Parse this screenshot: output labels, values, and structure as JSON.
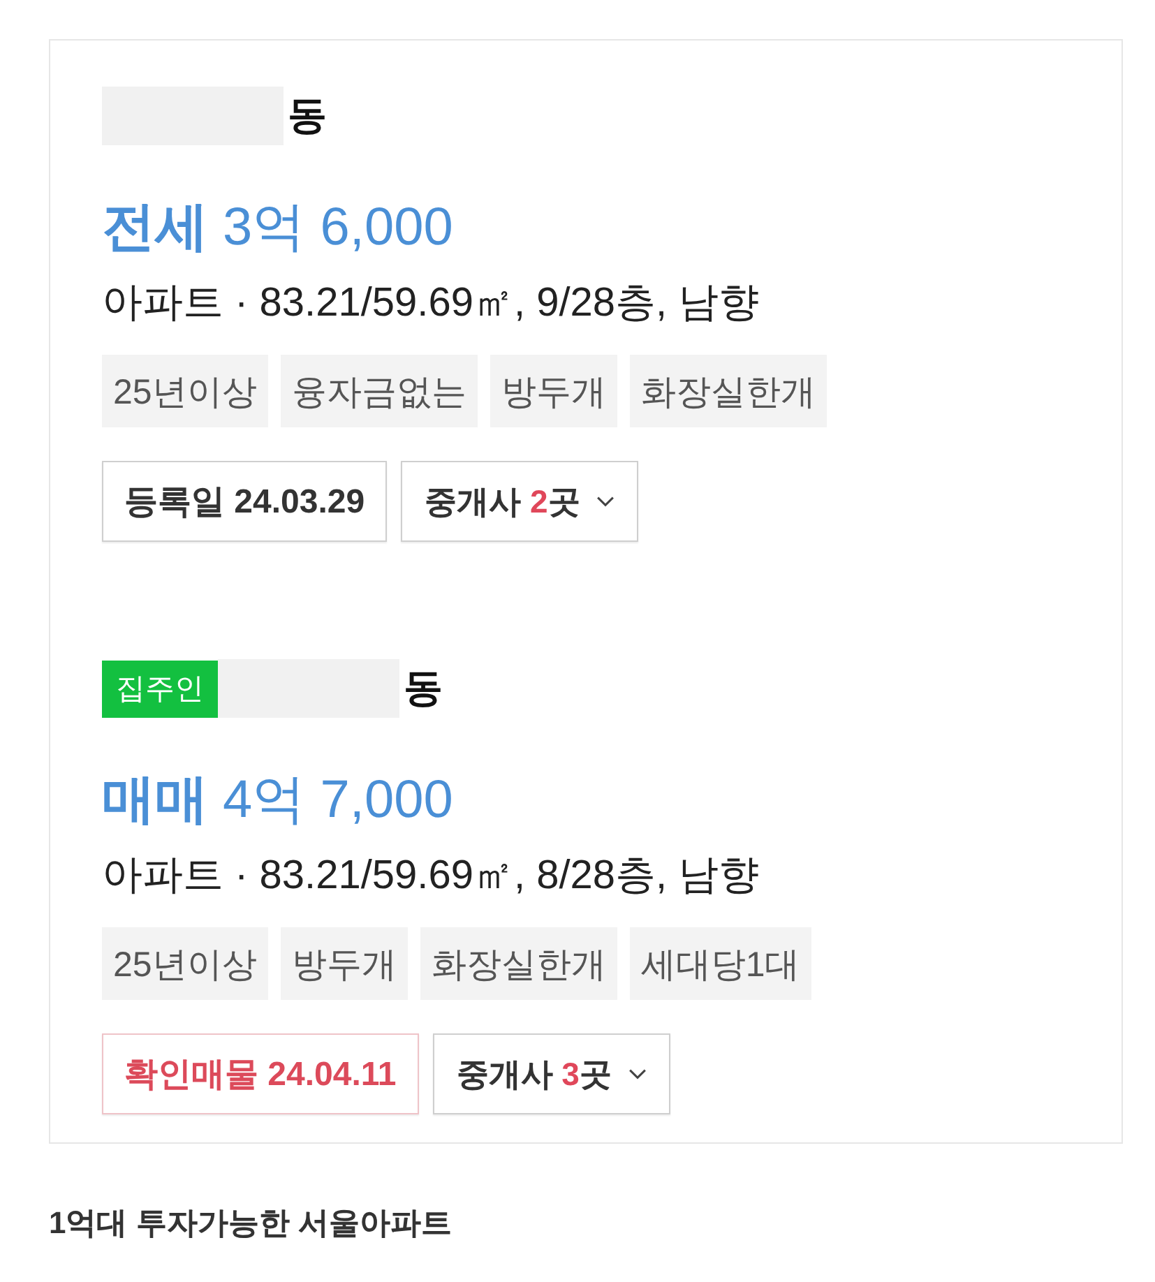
{
  "listings": [
    {
      "name_suffix": "동",
      "price": "**전세** 3억 6,000",
      "details": "아파트 · 83.21/59.69㎡, 9/28층, 남향",
      "tags": [
        "25년이상",
        "융자금없는",
        "방두개",
        "화장실한개"
      ],
      "date": {
        "kind": "registered",
        "text": "등록일 24.03.29"
      },
      "agents": {
        "label": "중개사",
        "count": "2",
        "unit": "곳"
      }
    },
    {
      "owner_badge": "집주인",
      "name_suffix": "동",
      "price": "**매매** 4억 7,000",
      "details": "아파트 · 83.21/59.69㎡, 8/28층, 남향",
      "tags": [
        "25년이상",
        "방두개",
        "화장실한개",
        "세대당1대"
      ],
      "date": {
        "kind": "confirmed",
        "text": "확인매물 24.04.11"
      },
      "agents": {
        "label": "중개사",
        "count": "3",
        "unit": "곳"
      }
    }
  ],
  "footer_title": "1억대 투자가능한 서울아파트"
}
